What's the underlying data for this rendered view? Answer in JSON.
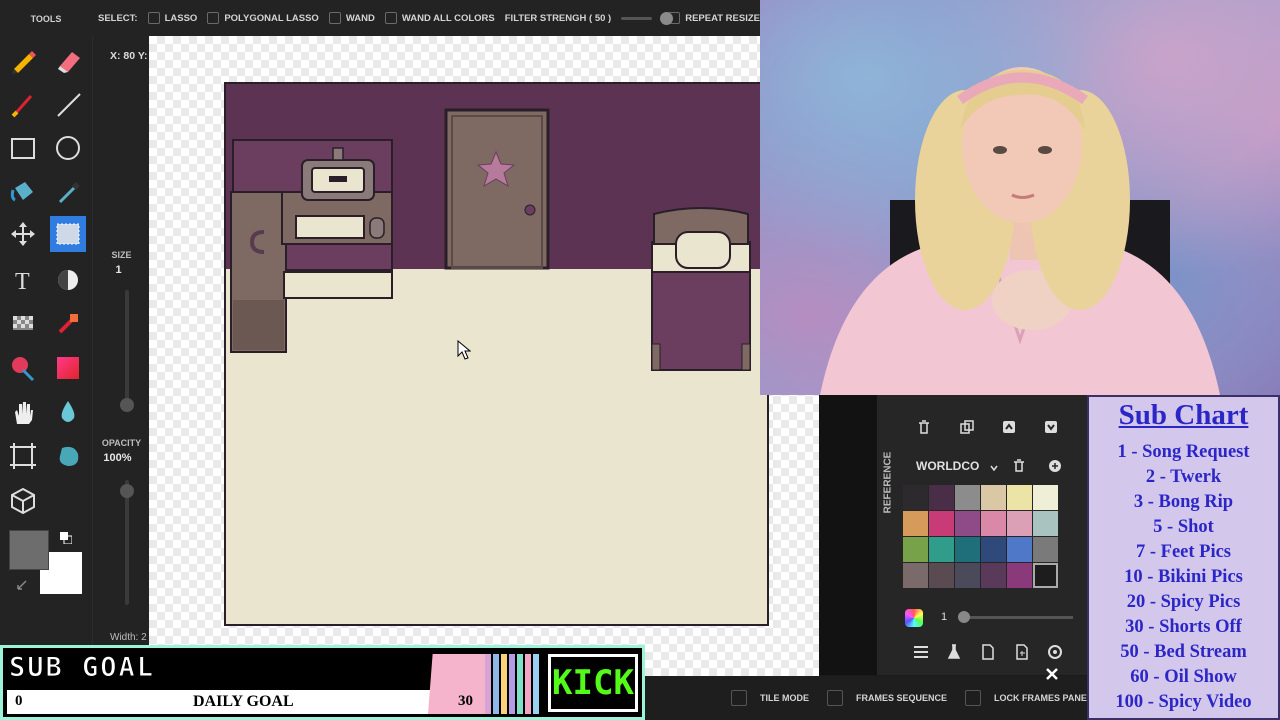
{
  "tools_panel": {
    "title": "TOOLS",
    "size_label": "SIZE",
    "size_value": "1",
    "opacity_label": "OPACITY",
    "opacity_value": "100%",
    "coord_readout": "X: 80 Y:",
    "width_label": "Width: 2",
    "primary_color": "#6d6d6d",
    "secondary_color": "#ffffff",
    "selected_tool_color": "#2f7de1"
  },
  "toolbar": {
    "select_label": "SELECT:",
    "lasso": "LASSO",
    "polygonal_lasso": "POLYGONAL LASSO",
    "wand": "WAND",
    "wand_all_colors": "WAND ALL COLORS",
    "filter_strength": "FILTER STRENGH ( 50 )",
    "filter_value": 50,
    "repeat_resize": "REPEAT RESIZE"
  },
  "right_panel": {
    "reference_tab": "REFERENCE",
    "palette_name": "WORLDCO",
    "layer_opacity_value": "1",
    "palette_colors": [
      [
        "#2d2a2d",
        "#4a2d46",
        "#8c8c8c",
        "#d9c7a6",
        "#ece4a6",
        "#efeed6"
      ],
      [
        "#d69a5a",
        "#c93b77",
        "#8e4b88",
        "#d988a8",
        "#dba0b5",
        "#a9c3c0"
      ],
      [
        "#78a24a",
        "#2f9d8a",
        "#1f6f7a",
        "#2f4a7a",
        "#4f79c8",
        "#7a7a7a"
      ],
      [
        "#7a6a6a",
        "#5a4a52",
        "#4a4a5a",
        "#5a3a5a",
        "#8a3a7a",
        "#ffffff"
      ]
    ]
  },
  "bottom_toolbar": {
    "tile_mode": "TILE MODE",
    "frames_sequence": "FRAMES SEQUENCE",
    "lock_frames_panel": "LOCK FRAMES PANEL"
  },
  "sub_goal": {
    "title": "SUB GOAL",
    "current": "0",
    "label": "DAILY GOAL",
    "target": "30",
    "kick_label": "KICK"
  },
  "sub_chart": {
    "title": "Sub Chart",
    "items": [
      "1 - Song Request",
      "2 - Twerk",
      "3 - Bong Rip",
      "5 - Shot",
      "7 - Feet Pics",
      "10 - Bikini Pics",
      "20 - Spicy Pics",
      "30 - Shorts Off",
      "50 - Bed Stream",
      "60 - Oil Show",
      "100 - Spicy Video"
    ]
  },
  "colors": {
    "wall": "#5c3352",
    "floor": "#e9e5cf",
    "outline": "#2a1f28",
    "chart_text": "#2b27c7",
    "chart_bg": "#d4c7ec",
    "kick_green": "#53fc18"
  }
}
